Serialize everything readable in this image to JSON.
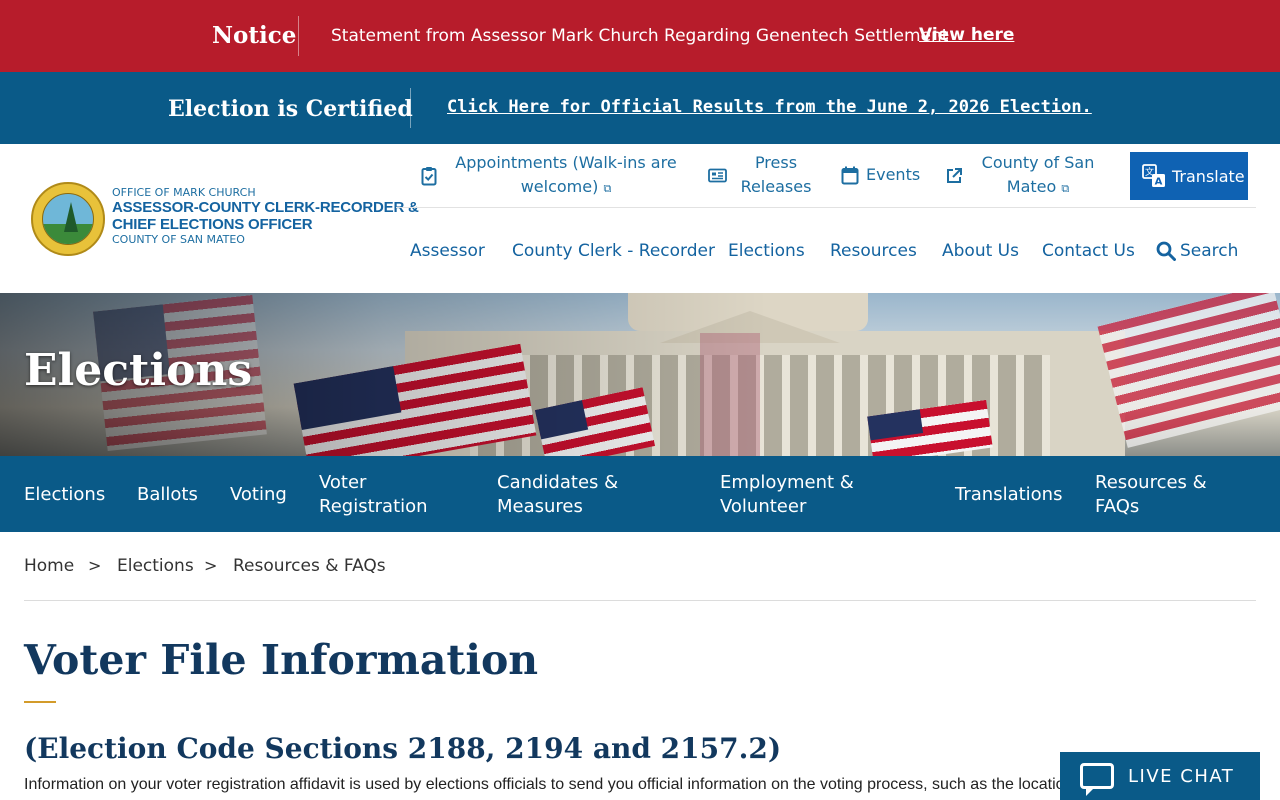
{
  "notice": {
    "label": "Notice",
    "text": "Statement from Assessor Mark Church Regarding Genentech Settlement",
    "link": "View here",
    "color": "#b71c2b"
  },
  "certified": {
    "label": "Election is Certified",
    "link": "Click Here for Official Results from the June 2, 2026 Election.",
    "color": "#0a5a88"
  },
  "logo": {
    "line1": "OFFICE OF MARK CHURCH",
    "line2": "ASSESSOR-COUNTY CLERK-RECORDER &",
    "line3": "CHIEF ELECTIONS OFFICER",
    "line4": "COUNTY OF SAN MATEO"
  },
  "utility": {
    "appointments": [
      "Appointments (Walk-ins are",
      "welcome)"
    ],
    "press": [
      "Press",
      "Releases"
    ],
    "events": "Events",
    "county": [
      "County of San",
      "Mateo"
    ],
    "translate": "Translate"
  },
  "nav": {
    "items": [
      "Assessor",
      "County Clerk - Recorder",
      "Elections",
      "Resources",
      "About Us",
      "Contact Us"
    ],
    "search": "Search"
  },
  "hero": {
    "title": "Elections"
  },
  "subnav": {
    "elections": "Elections",
    "ballots": "Ballots",
    "voting": "Voting",
    "voter_registration": [
      "Voter",
      "Registration"
    ],
    "candidates": [
      "Candidates &",
      "Measures"
    ],
    "employment": [
      "Employment &",
      "Volunteer"
    ],
    "translations": "Translations",
    "resources": [
      "Resources &",
      "FAQs"
    ]
  },
  "breadcrumb": {
    "items": [
      "Home",
      "Elections",
      "Resources & FAQs"
    ],
    "separator": ">"
  },
  "page": {
    "title": "Voter File Information",
    "subtitle": "(Election Code Sections 2188, 2194 and 2157.2)",
    "intro": "Information on your voter registration affidavit is used by elections officials to send you official information on the voting process, such as the location"
  },
  "chat": {
    "label": "LIVE CHAT"
  },
  "icons": {
    "appointments": "clipboard-check-icon",
    "press": "newspaper-icon",
    "events": "calendar-icon",
    "county": "external-link-icon",
    "translate": "translate-icon",
    "search": "search-icon",
    "chat": "chat-bubble-icon"
  }
}
